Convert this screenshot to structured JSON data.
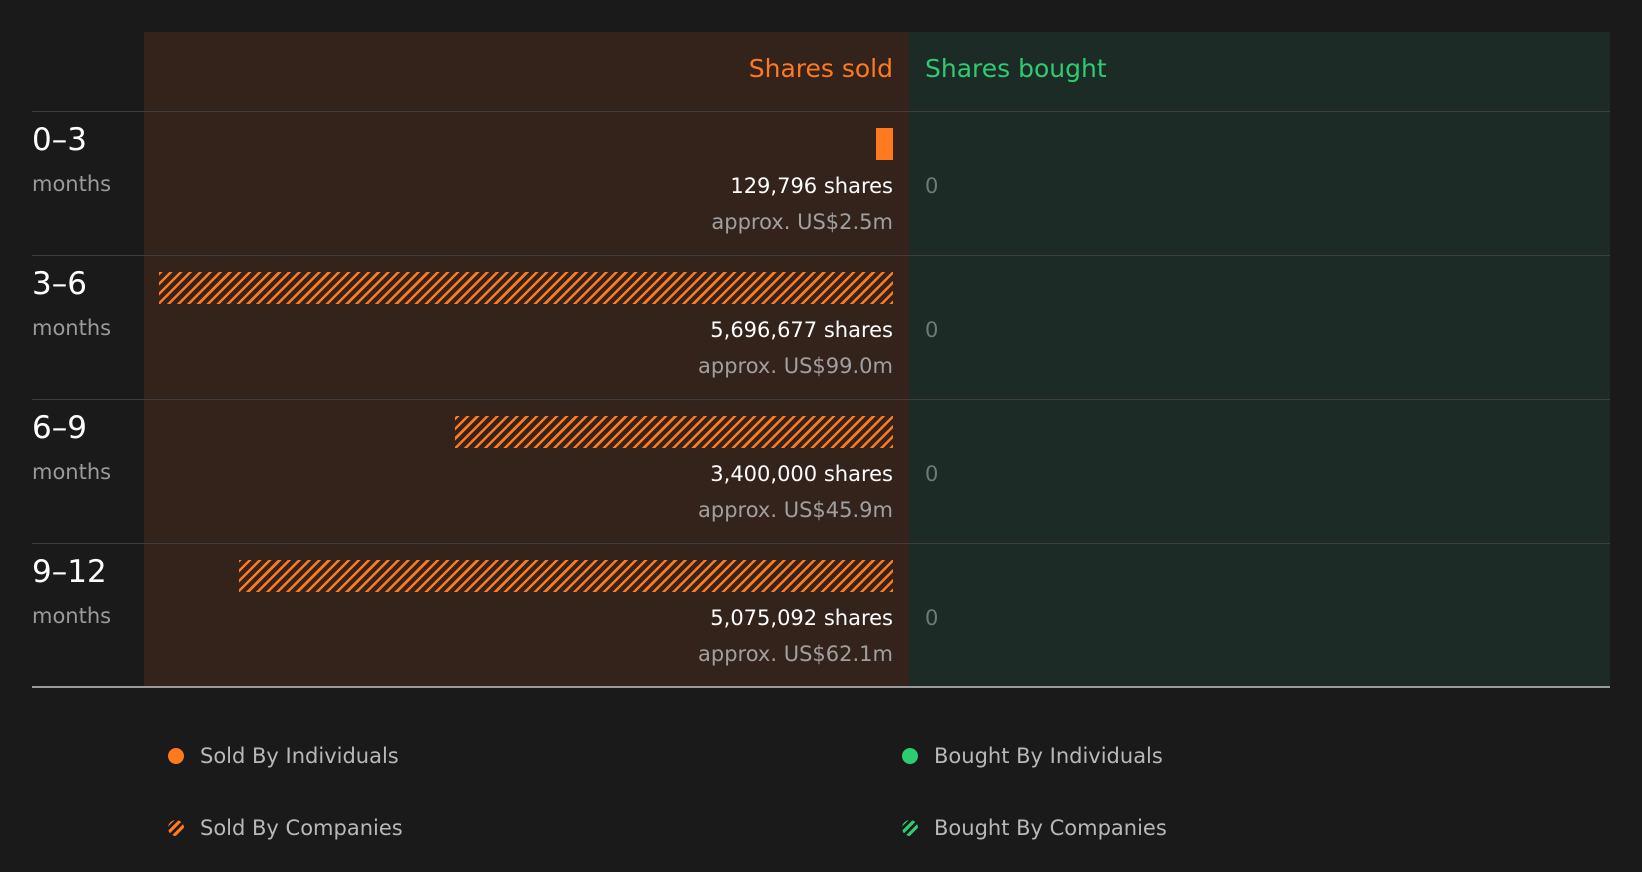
{
  "colors": {
    "sold": "#ff7a1f",
    "bought": "#2ecc71",
    "background": "#1a1a1a"
  },
  "header": {
    "sold": "Shares sold",
    "bought": "Shares bought"
  },
  "chart_data": {
    "type": "bar",
    "orientation": "horizontal",
    "categories": [
      "0–3 months",
      "3–6 months",
      "6–9 months",
      "9–12 months"
    ],
    "series": [
      {
        "name": "Sold By Individuals",
        "values": [
          129796,
          0,
          0,
          0
        ]
      },
      {
        "name": "Sold By Companies",
        "values": [
          0,
          5696677,
          3400000,
          5075092
        ]
      },
      {
        "name": "Bought By Individuals",
        "values": [
          0,
          0,
          0,
          0
        ]
      },
      {
        "name": "Bought By Companies",
        "values": [
          0,
          0,
          0,
          0
        ]
      }
    ],
    "rows": [
      {
        "period": "0–3",
        "unit": "months",
        "sold_shares": 129796,
        "sold_type": "individuals",
        "sold_label": "129,796 shares",
        "value_label": "approx. US$2.5m",
        "bought_label": "0"
      },
      {
        "period": "3–6",
        "unit": "months",
        "sold_shares": 5696677,
        "sold_type": "companies",
        "sold_label": "5,696,677 shares",
        "value_label": "approx. US$99.0m",
        "bought_label": "0"
      },
      {
        "period": "6–9",
        "unit": "months",
        "sold_shares": 3400000,
        "sold_type": "companies",
        "sold_label": "3,400,000 shares",
        "value_label": "approx. US$45.9m",
        "bought_label": "0"
      },
      {
        "period": "9–12",
        "unit": "months",
        "sold_shares": 5075092,
        "sold_type": "companies",
        "sold_label": "5,075,092 shares",
        "value_label": "approx. US$62.1m",
        "bought_label": "0"
      }
    ],
    "legend": [
      {
        "label": "Sold By Individuals",
        "style": "solid",
        "color": "#ff7a1f"
      },
      {
        "label": "Bought By Individuals",
        "style": "solid",
        "color": "#2ecc71"
      },
      {
        "label": "Sold By Companies",
        "style": "hatched",
        "color": "#ff7a1f"
      },
      {
        "label": "Bought By Companies",
        "style": "hatched",
        "color": "#2ecc71"
      }
    ],
    "legend_position": "bottom"
  }
}
